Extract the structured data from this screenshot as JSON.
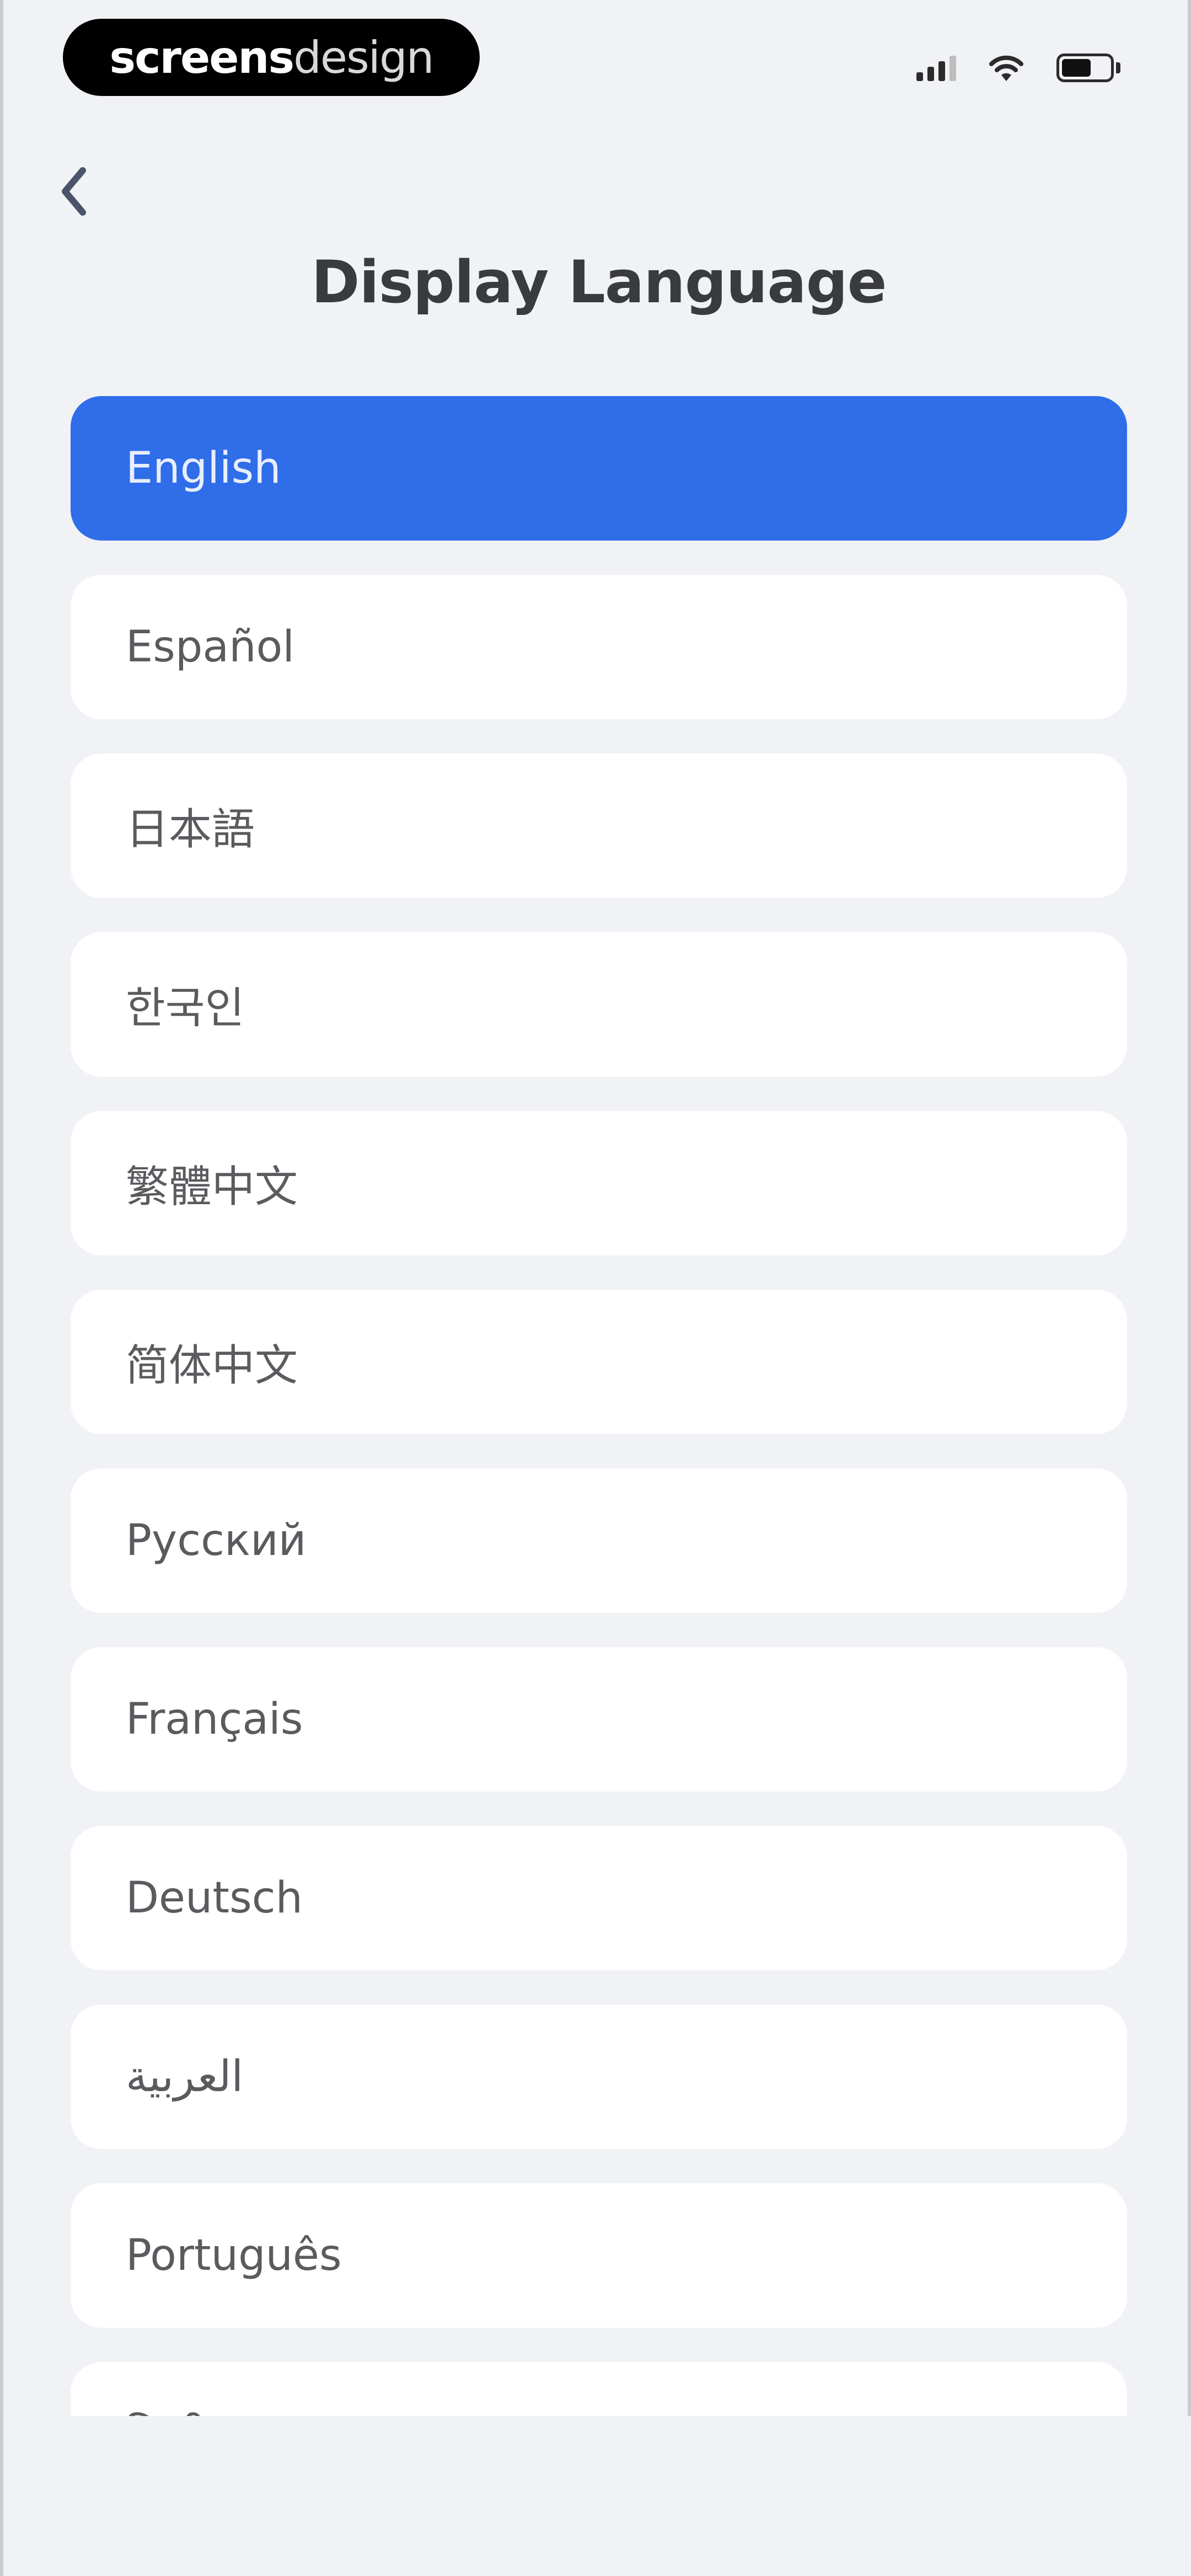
{
  "status_bar": {
    "brand_word_1": "screens",
    "brand_word_2": "design",
    "icons": [
      "signal-icon",
      "wifi-icon",
      "battery-icon"
    ]
  },
  "header": {
    "back_icon": "chevron-left-icon",
    "title": "Display Language"
  },
  "colors": {
    "background": "#f1f2f5",
    "accent": "#2f6de9",
    "item_background": "#ffffff",
    "text": "#5a5b5e",
    "title": "#3a3b3e"
  },
  "languages": [
    {
      "label": "English",
      "selected": true
    },
    {
      "label": "Español",
      "selected": false
    },
    {
      "label": "日本語",
      "selected": false
    },
    {
      "label": "한국인",
      "selected": false
    },
    {
      "label": "繁體中文",
      "selected": false
    },
    {
      "label": "简体中文",
      "selected": false
    },
    {
      "label": "Русский",
      "selected": false
    },
    {
      "label": "Français",
      "selected": false
    },
    {
      "label": "Deutsch",
      "selected": false
    },
    {
      "label": "العربية",
      "selected": false
    },
    {
      "label": "Português",
      "selected": false
    },
    {
      "label": "हिन्दी",
      "selected": false
    }
  ]
}
